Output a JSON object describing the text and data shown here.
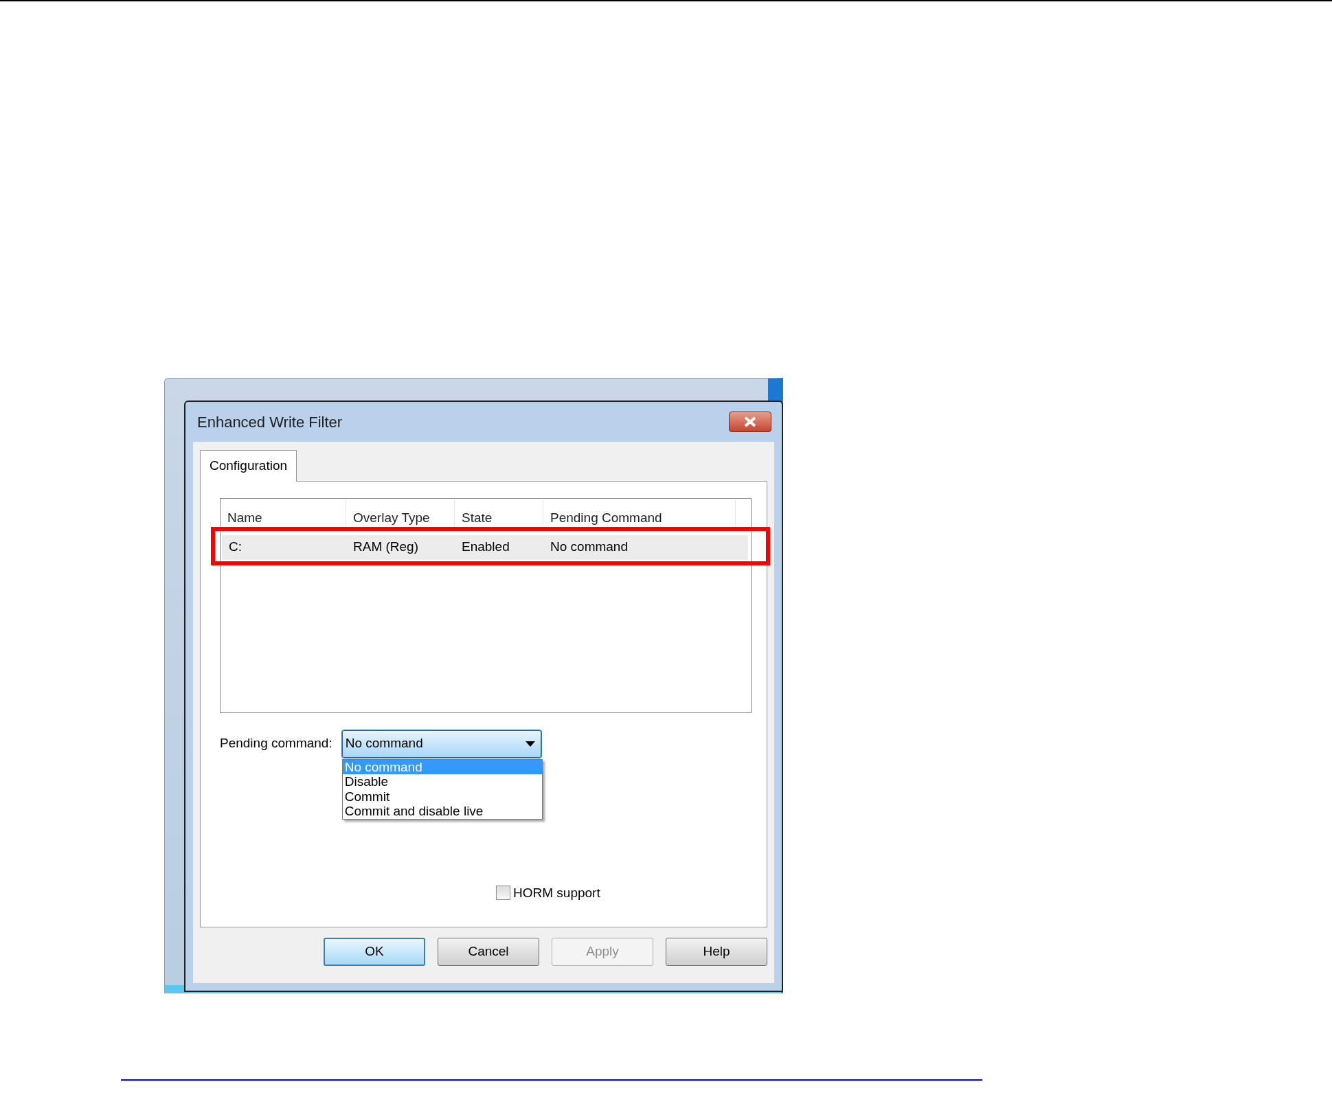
{
  "dialog": {
    "title": "Enhanced Write Filter"
  },
  "tabs": [
    {
      "label": "Configuration",
      "selected": true
    }
  ],
  "table": {
    "columns": [
      "Name",
      "Overlay Type",
      "State",
      "Pending Command"
    ],
    "rows": [
      {
        "cells": [
          "C:",
          "RAM (Reg)",
          "Enabled",
          "No command"
        ],
        "selected": true,
        "highlighted": true
      }
    ]
  },
  "pending_command": {
    "label": "Pending command:",
    "value": "No command",
    "expanded": true,
    "options": [
      {
        "label": "No command",
        "selected": true
      },
      {
        "label": "Disable",
        "selected": false
      },
      {
        "label": "Commit",
        "selected": false
      },
      {
        "label": "Commit and disable live",
        "selected": false
      }
    ]
  },
  "horm_support": {
    "label": "HORM support",
    "checked": false
  },
  "buttons": [
    {
      "label": "OK",
      "default": true,
      "disabled": false
    },
    {
      "label": "Cancel",
      "default": false,
      "disabled": false
    },
    {
      "label": "Apply",
      "default": false,
      "disabled": true
    },
    {
      "label": "Help",
      "default": false,
      "disabled": false
    }
  ]
}
